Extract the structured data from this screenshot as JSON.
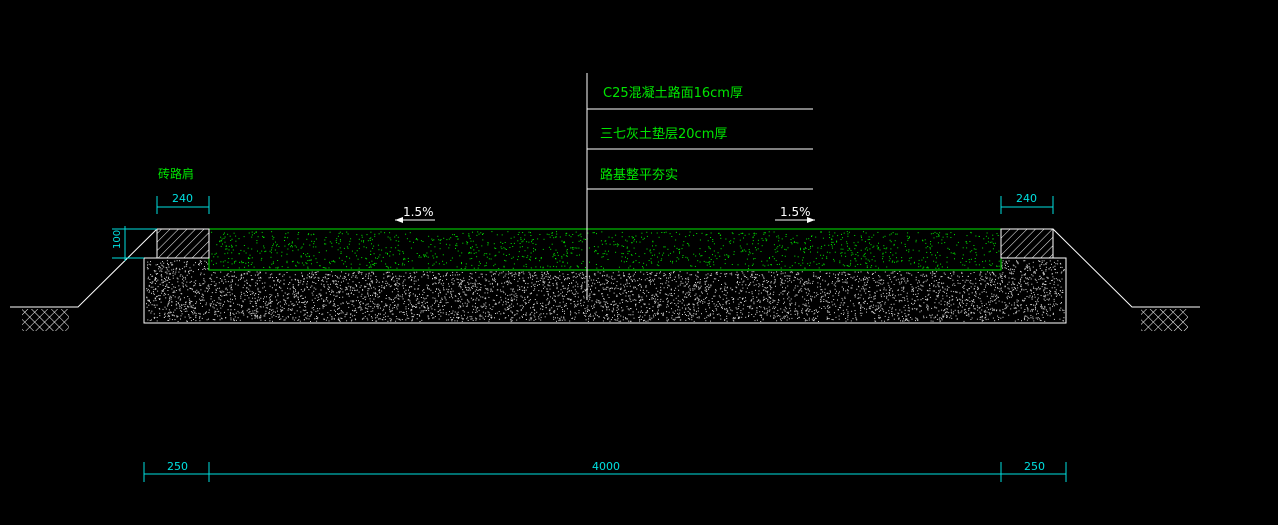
{
  "layer_labels": [
    "C25混凝土路面16cm厚",
    "三七灰土垫层20cm厚",
    "路基整平夯实"
  ],
  "shoulder_label": "砖路肩",
  "slope": {
    "left": "1.5%",
    "right": "1.5%"
  },
  "dimensions": {
    "shoulder_width_left": "240",
    "shoulder_width_right": "240",
    "shoulder_height": "100",
    "bottom_left": "250",
    "bottom_center": "4000",
    "bottom_right": "250"
  },
  "colors": {
    "background": "#000000",
    "concrete": "#00e600",
    "lines": "#ffffff",
    "dimensions": "#00e0e0"
  }
}
